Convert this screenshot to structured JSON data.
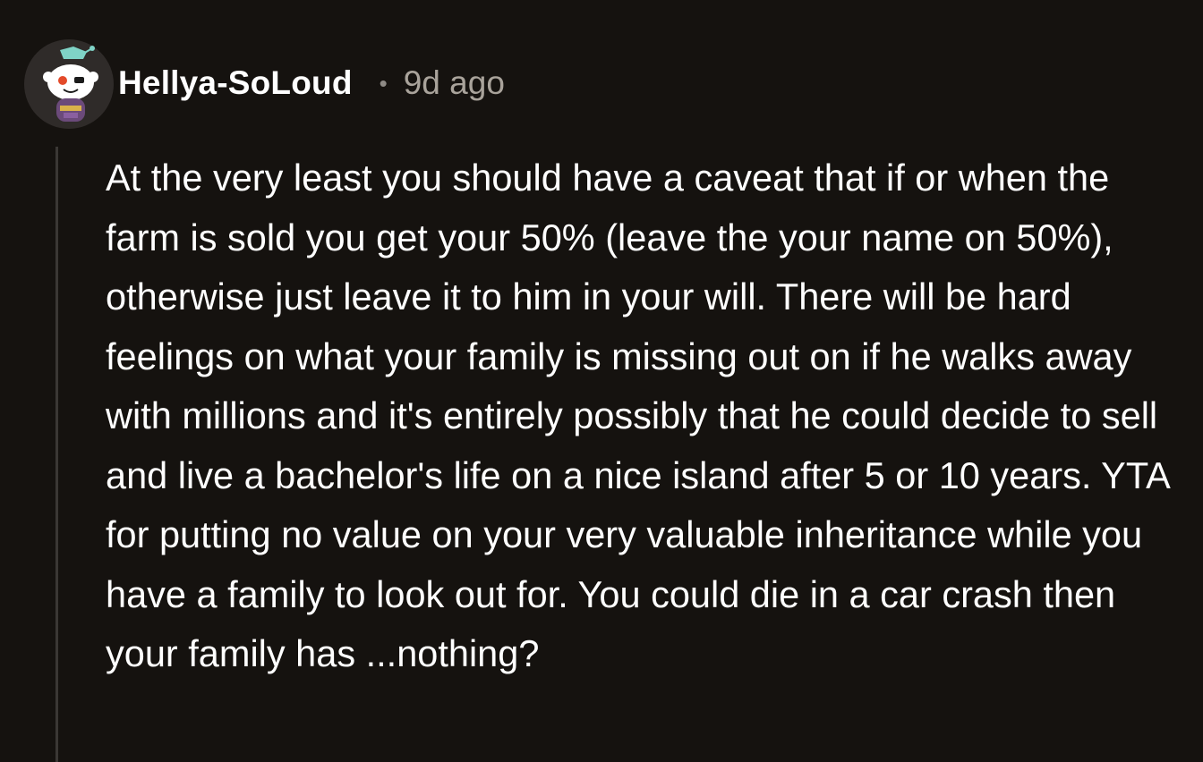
{
  "comment": {
    "author": "Hellya-SoLoud",
    "separator": "•",
    "timestamp": "9d ago",
    "avatar_icon": "snoo-avatar-icon",
    "body": "At the very least you should have a caveat that if or when the farm is sold you get your 50% (leave the your name on 50%), otherwise just leave it to him in your will. There will be hard feelings on what your family is missing out on if he walks away with millions and it's entirely possibly that he could decide to sell and live a bachelor's life on a nice island after 5 or 10 years. YTA for putting no value on your very valuable inheritance while you have a family to look out for. You could die in a car crash then your family has ...nothing?"
  },
  "colors": {
    "background": "#15120f",
    "text": "#ffffff",
    "meta": "#a9a39b",
    "thread_line": "#3a3734"
  }
}
